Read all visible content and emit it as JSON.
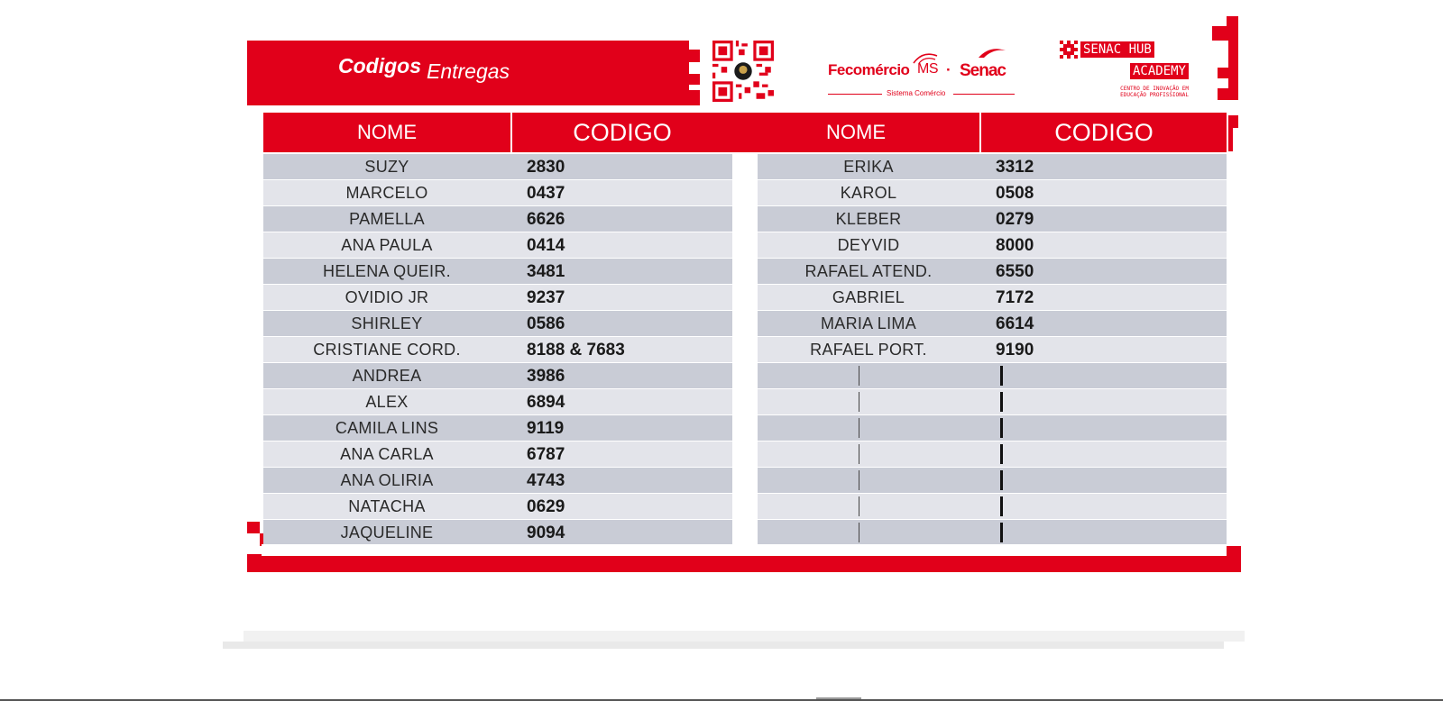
{
  "header": {
    "title_bold": "Codigos",
    "title_rest": "Entregas"
  },
  "logos": {
    "fecomercio": "Fecomércio",
    "fecomercio_state": "MS",
    "separator": "·",
    "senac": "Senac",
    "sistema": "Sistema Comércio",
    "hub_line1": "SENAC HUB",
    "hub_line2": "ACADEMY",
    "hub_sub1": "CENTRO DE INOVAÇÃO EM",
    "hub_sub2": "EDUCAÇÃO PROFISSIONAL"
  },
  "table": {
    "col_nome": "NOME",
    "col_codigo": "CODIGO",
    "left": [
      {
        "name": "SUZY",
        "code": "2830"
      },
      {
        "name": "MARCELO",
        "code": "0437"
      },
      {
        "name": "PAMELLA",
        "code": "6626"
      },
      {
        "name": "ANA PAULA",
        "code": "0414"
      },
      {
        "name": "HELENA QUEIR.",
        "code": "3481"
      },
      {
        "name": "OVIDIO JR",
        "code": "9237"
      },
      {
        "name": "SHIRLEY",
        "code": "0586"
      },
      {
        "name": "CRISTIANE CORD.",
        "code": "8188 & 7683"
      },
      {
        "name": "ANDREA",
        "code": "3986"
      },
      {
        "name": "ALEX",
        "code": "6894"
      },
      {
        "name": "CAMILA LINS",
        "code": "9119"
      },
      {
        "name": "ANA CARLA",
        "code": "6787"
      },
      {
        "name": "ANA OLIRIA",
        "code": "4743"
      },
      {
        "name": "NATACHA",
        "code": "0629"
      },
      {
        "name": "JAQUELINE",
        "code": "9094"
      }
    ],
    "right": [
      {
        "name": "ERIKA",
        "code": "3312"
      },
      {
        "name": "KAROL",
        "code": "0508"
      },
      {
        "name": "KLEBER",
        "code": "0279"
      },
      {
        "name": "DEYVID",
        "code": "8000"
      },
      {
        "name": "RAFAEL ATEND.",
        "code": "6550"
      },
      {
        "name": "GABRIEL",
        "code": "7172"
      },
      {
        "name": "MARIA LIMA",
        "code": "6614"
      },
      {
        "name": "RAFAEL PORT.",
        "code": "9190"
      },
      {
        "name": "",
        "code": ""
      },
      {
        "name": "",
        "code": ""
      },
      {
        "name": "",
        "code": ""
      },
      {
        "name": "",
        "code": ""
      },
      {
        "name": "",
        "code": ""
      },
      {
        "name": "",
        "code": ""
      },
      {
        "name": "",
        "code": ""
      }
    ]
  },
  "colors": {
    "brand_red": "#e1001a",
    "row_dark": "#c9ccd6",
    "row_light": "#e3e4ea"
  }
}
